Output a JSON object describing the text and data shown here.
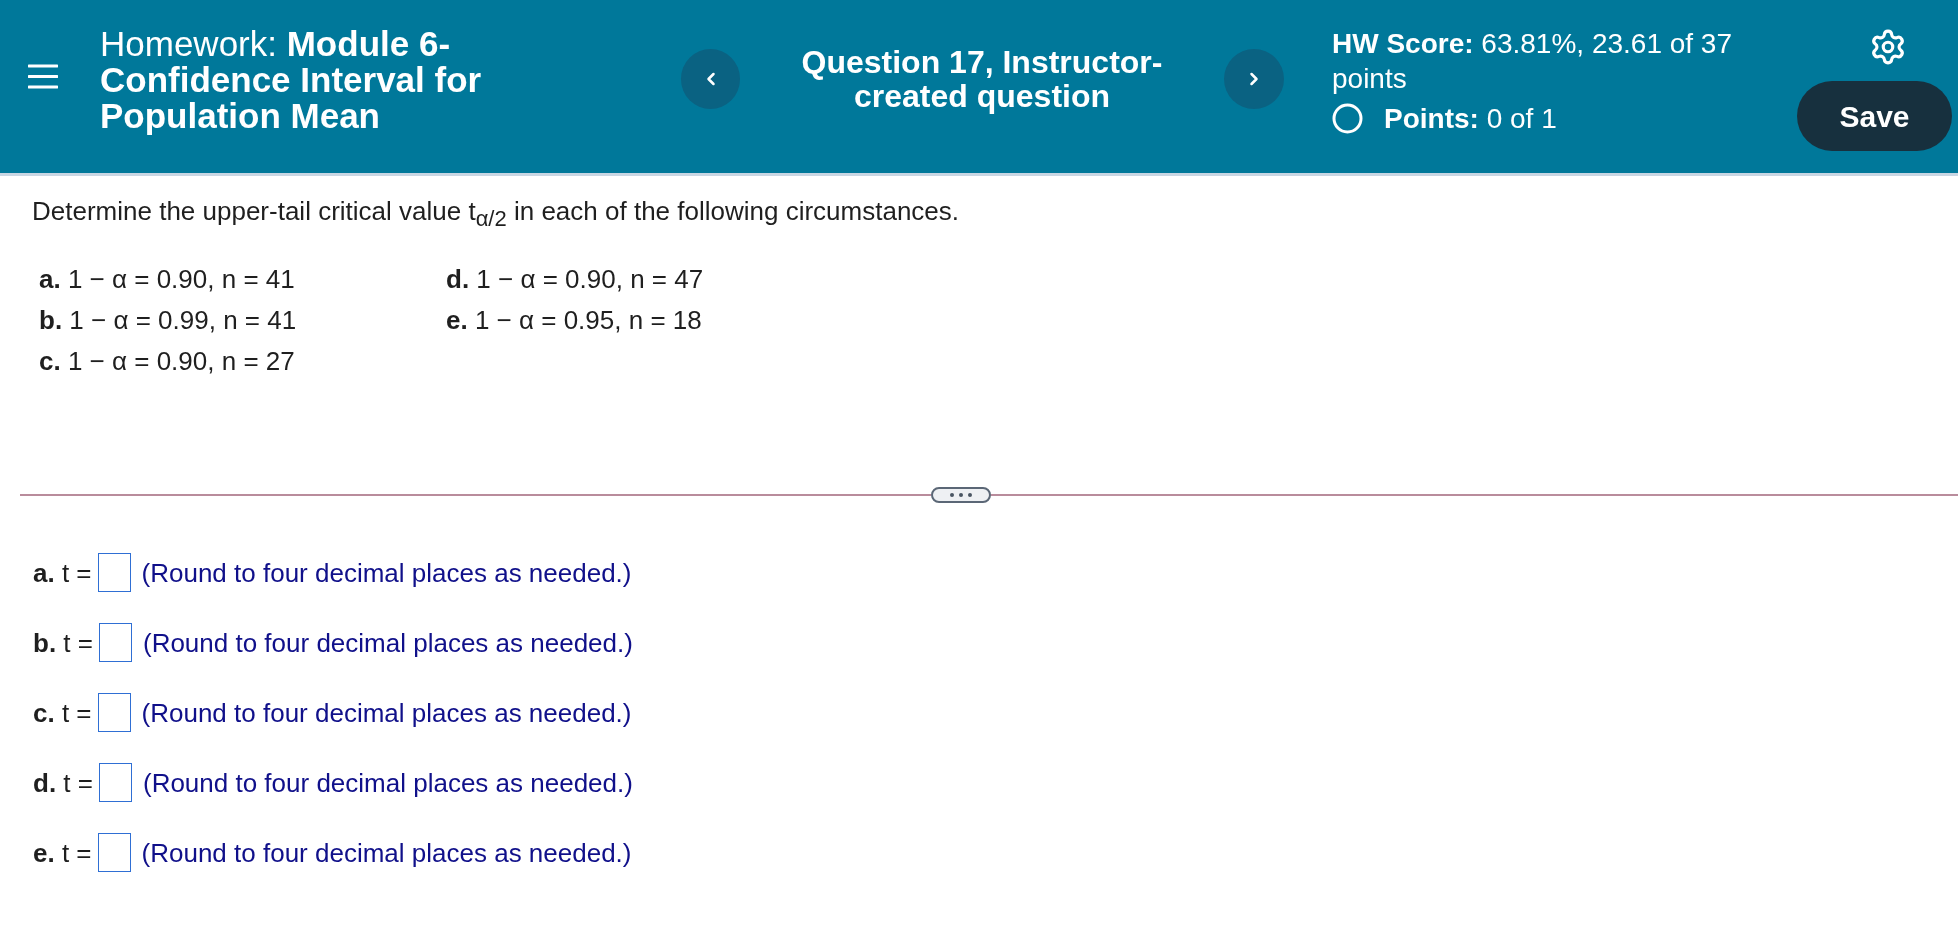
{
  "header": {
    "title": "Homework: **Module 6-Confidence Interval for Population Mean**",
    "question_title": "Question 17, Instructor-created question",
    "score": "**HW Score:** 63.81%, 23.61 of 37 points",
    "points": "**Points:** 0 of 1",
    "save_button": "Save"
  },
  "question": {
    "prompt": "Determine the upper-tail critical value t$_{α/2}$ in each of the following circumstances.",
    "parts": [
      "**a.** 1 − α = 0.90, n = 41",
      "**b.** 1 − α = 0.99, n = 41",
      "**c.** 1 − α = 0.90, n = 27",
      "**d.** 1 − α = 0.90, n = 47",
      "**e.** 1 − α = 0.95, n = 18"
    ]
  },
  "answers": [
    {
      "label": "**a.** t =",
      "hint": "(Round to four decimal places as needed.)"
    },
    {
      "label": "**b.** t =",
      "hint": "(Round to four decimal places as needed.)"
    },
    {
      "label": "**c.** t =",
      "hint": "(Round to four decimal places as needed.)"
    },
    {
      "label": "**d.** t =",
      "hint": "(Round to four decimal places as needed.)"
    },
    {
      "label": "**e.** t =",
      "hint": "(Round to four decimal places as needed.)"
    }
  ]
}
